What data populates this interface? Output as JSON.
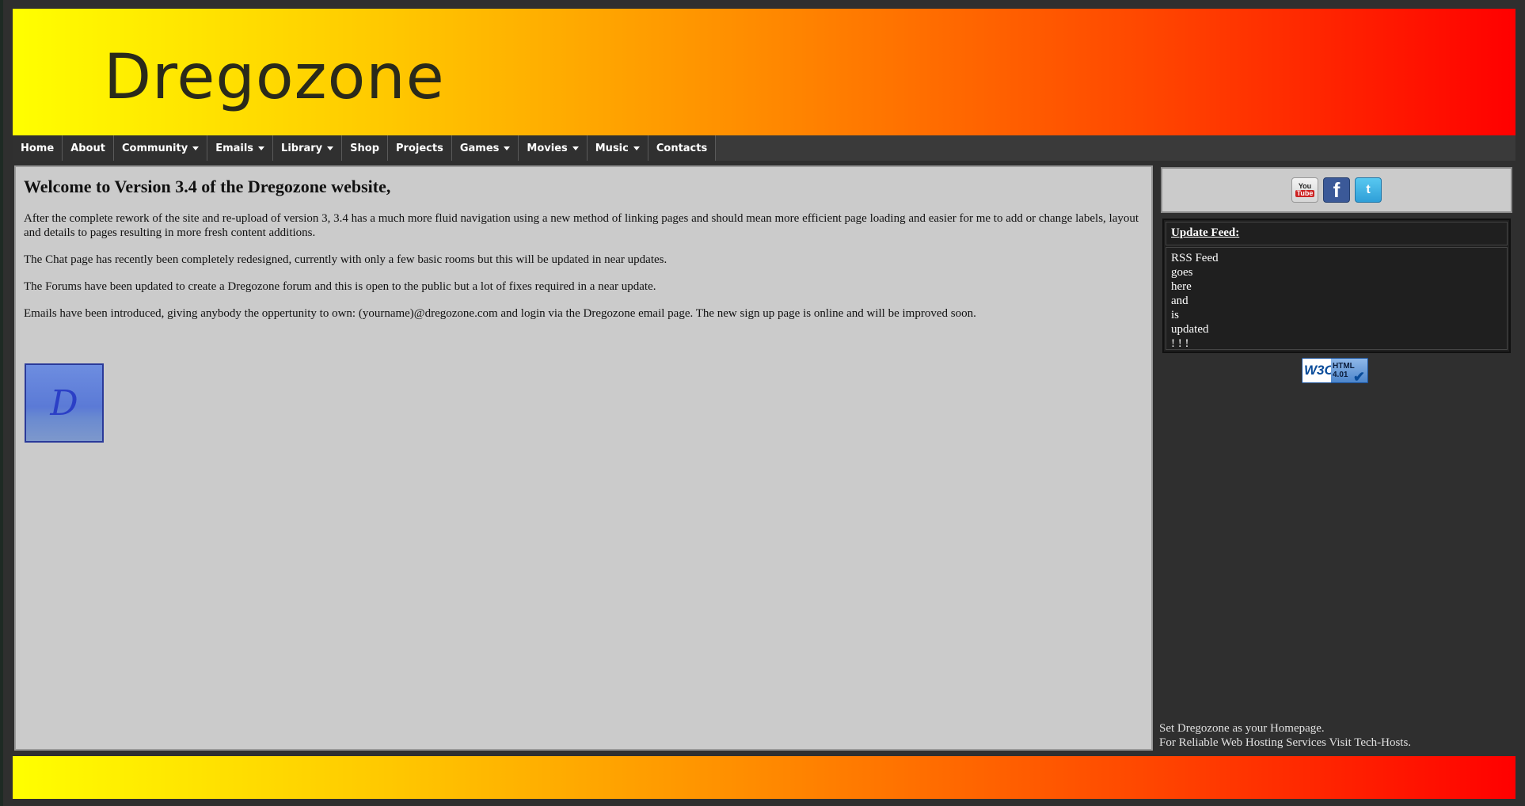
{
  "header": {
    "title": "Dregozone"
  },
  "nav": {
    "items": [
      {
        "label": "Home",
        "dropdown": false
      },
      {
        "label": "About",
        "dropdown": false
      },
      {
        "label": "Community",
        "dropdown": true
      },
      {
        "label": "Emails",
        "dropdown": true
      },
      {
        "label": "Library",
        "dropdown": true
      },
      {
        "label": "Shop",
        "dropdown": false
      },
      {
        "label": "Projects",
        "dropdown": false
      },
      {
        "label": "Games",
        "dropdown": true
      },
      {
        "label": "Movies",
        "dropdown": true
      },
      {
        "label": "Music",
        "dropdown": true
      },
      {
        "label": "Contacts",
        "dropdown": false
      }
    ]
  },
  "main": {
    "heading": "Welcome to Version 3.4 of the Dregozone website,",
    "paragraphs": [
      "After the complete rework of the site and re-upload of version 3, 3.4 has a much more fluid navigation using a new method of linking pages and should mean more efficient page loading and easier for me to add or change labels, layout and details to pages resulting in more fresh content additions.",
      "The Chat page has recently been completely redesigned, currently with only a few basic rooms but this will be updated in near updates.",
      "The Forums have been updated to create a Dregozone forum and this is open to the public but a lot of fixes required in a near update.",
      "Emails have been introduced, giving anybody the oppertunity to own: (yourname)@dregozone.com and login via the Dregozone email page. The new sign up page is online and will be improved soon."
    ],
    "logo_letter": "D"
  },
  "sidebar": {
    "social": {
      "youtube_top": "You",
      "youtube_bottom": "Tube",
      "facebook": "f",
      "twitter": "t"
    },
    "feed": {
      "title": "Update Feed:",
      "lines": [
        "RSS Feed",
        "goes",
        "here",
        "and",
        "is",
        "updated",
        "! ! !"
      ]
    },
    "w3c": {
      "left": "W3C",
      "line1": "HTML",
      "line2": "4.01"
    },
    "footer_line1": "Set Dregozone as your Homepage.",
    "footer_line2": "For Reliable Web Hosting Services Visit Tech-Hosts."
  },
  "colors": {
    "gradient_start": "#ffff00",
    "gradient_end": "#ff0000",
    "background": "#2f2f2f",
    "content_bg": "#cbcbcb"
  }
}
